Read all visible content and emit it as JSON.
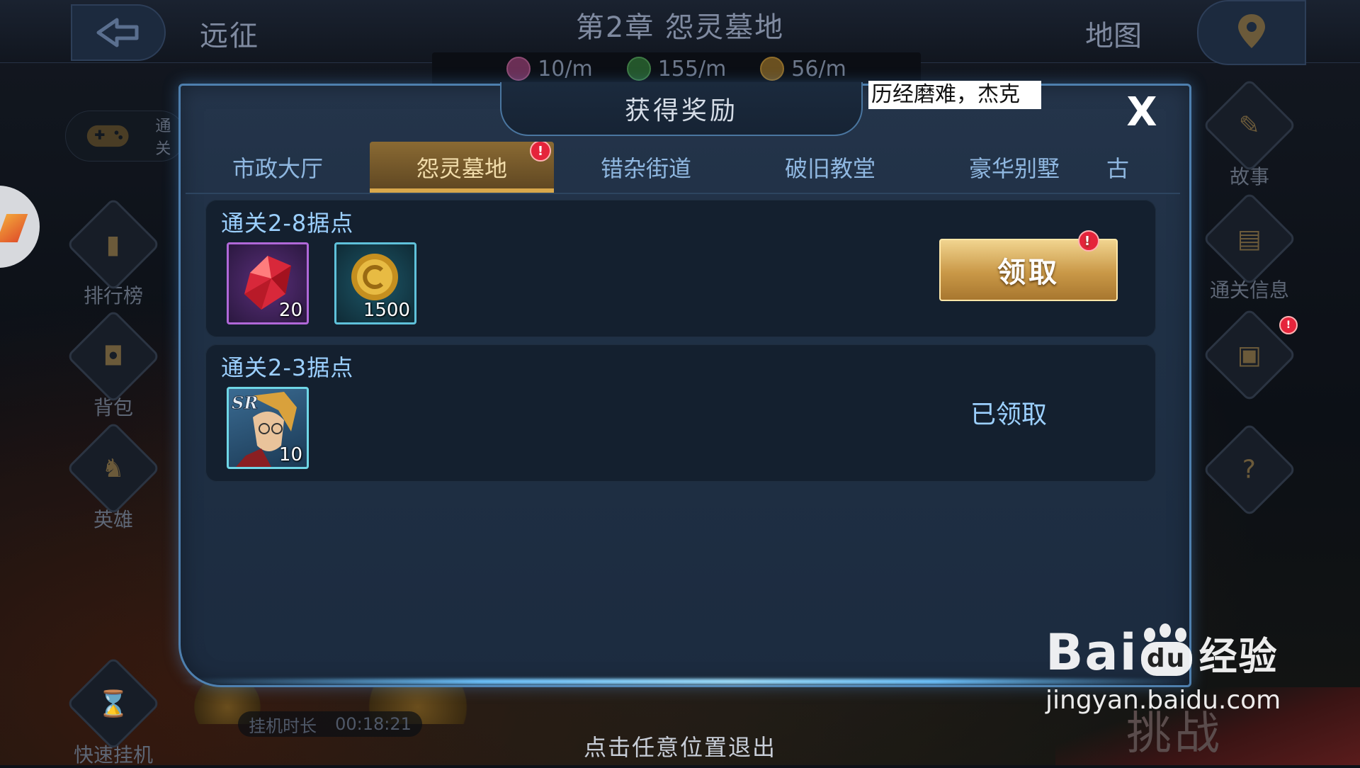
{
  "header": {
    "back_label": "远征",
    "chapter_title": "第2章  怨灵墓地",
    "map_label": "地图"
  },
  "rates": [
    {
      "value": "10/m",
      "color": "#b14d8a"
    },
    {
      "value": "155/m",
      "color": "#3e9a44"
    },
    {
      "value": "56/m",
      "color": "#c69226"
    }
  ],
  "left_menu": {
    "tab_text": "通关",
    "items": [
      "排行榜",
      "背包",
      "英雄",
      "快速挂机"
    ]
  },
  "right_menu": {
    "items": [
      "故事",
      "通关信息",
      "",
      ""
    ]
  },
  "idle": {
    "label": "挂机时长",
    "time": "00:18:21"
  },
  "dialog": {
    "title": "获得奖励",
    "ticker": "历经磨难，杰克",
    "close_label": "X",
    "tabs": [
      {
        "label": "市政大厅",
        "active": false,
        "badge": false
      },
      {
        "label": "怨灵墓地",
        "active": true,
        "badge": true
      },
      {
        "label": "错杂街道",
        "active": false,
        "badge": false
      },
      {
        "label": "破旧教堂",
        "active": false,
        "badge": false
      },
      {
        "label": "豪华别墅",
        "active": false,
        "badge": false
      },
      {
        "label": "古",
        "active": false,
        "badge": false
      }
    ],
    "rewards": [
      {
        "title": "通关2-8据点",
        "items": [
          {
            "icon": "red-gem-icon",
            "qty": "20"
          },
          {
            "icon": "gold-coin-icon",
            "qty": "1500"
          }
        ],
        "action_label": "领取",
        "claimed": false
      },
      {
        "title": "通关2-3据点",
        "items": [
          {
            "icon": "sr-hero-portrait-icon",
            "qty": "10",
            "tag": "SR"
          }
        ],
        "action_label": "已领取",
        "claimed": true
      }
    ]
  },
  "exit_hint": "点击任意位置退出",
  "challenge_text": "挑战",
  "watermark": {
    "brand_left": "Bai",
    "brand_paw": "du",
    "brand_right": "经验",
    "url": "jingyan.baidu.com"
  }
}
